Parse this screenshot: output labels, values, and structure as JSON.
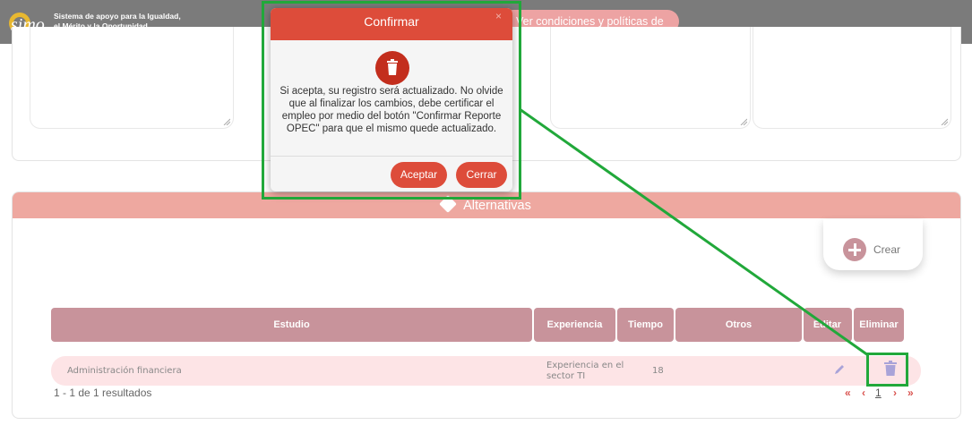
{
  "header": {
    "logo_text": "simo",
    "app_name_line1": "Sistema de apoyo para la Igualdad,",
    "app_name_line2": "el Mérito y la Oportunidad",
    "terms_link": "Ver condiciones y políticas de uso"
  },
  "alternatives": {
    "section_title": "Alternativas",
    "create_label": "Crear",
    "columns": [
      "Estudio",
      "Experiencia",
      "Tiempo",
      "Otros",
      "Editar",
      "Eliminar"
    ],
    "rows": [
      {
        "estudio": "Administración financiera",
        "experiencia": "Experiencia en el sector TI",
        "tiempo": "18",
        "otros": ""
      }
    ],
    "results_text": "1 - 1 de 1 resultados",
    "pager": {
      "first": "«",
      "prev": "‹",
      "page": "1",
      "next": "›",
      "last": "»"
    }
  },
  "modal": {
    "title": "Confirmar",
    "close": "×",
    "message": "Si acepta, su registro será actualizado. No olvide que al finalizar los cambios, debe certificar el empleo por medio del botón \"Confirmar Reporte OPEC\" para que el mismo quede actualizado.",
    "accept": "Aceptar",
    "close_button": "Cerrar"
  },
  "colors": {
    "header_bg": "#7b7b7b",
    "accent_red": "#dd4c3a",
    "section_pink": "#eea8a0",
    "table_header": "#c8939b",
    "row_bg": "#fde4e6",
    "annotation_green": "#21a83a"
  }
}
